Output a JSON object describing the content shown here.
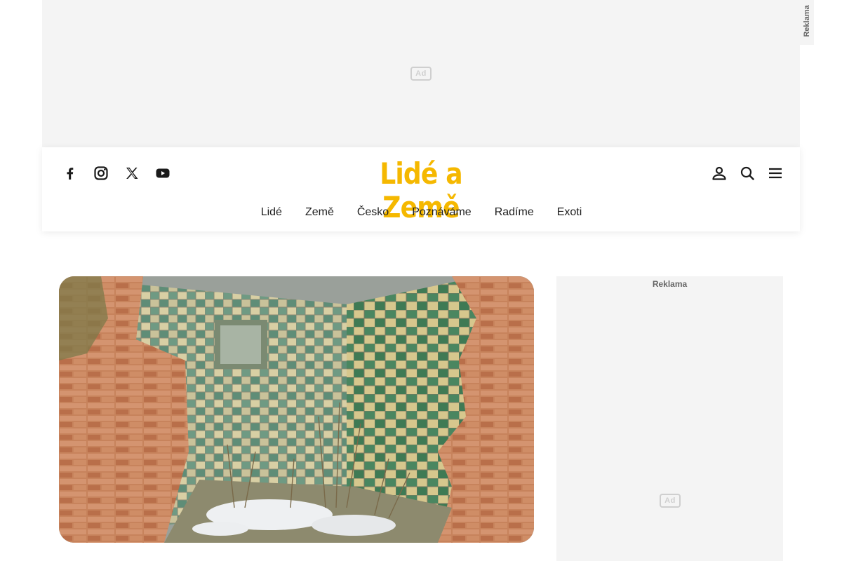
{
  "top_ad": {
    "badge": "Ad"
  },
  "side_tag": {
    "label": "Reklama"
  },
  "header": {
    "logo": "Lidé a Země",
    "social_icons": [
      "facebook-icon",
      "instagram-icon",
      "x-icon",
      "youtube-icon"
    ],
    "tool_icons": [
      "user-icon",
      "search-icon",
      "menu-icon"
    ],
    "nav": [
      "Lidé",
      "Země",
      "Česko",
      "Poznáváme",
      "Radíme",
      "Exoti"
    ]
  },
  "sidebar_ad": {
    "label": "Reklama",
    "badge": "Ad"
  },
  "colors": {
    "brand": "#f5b800",
    "ad_bg": "#f4f4f4",
    "text": "#222222"
  }
}
